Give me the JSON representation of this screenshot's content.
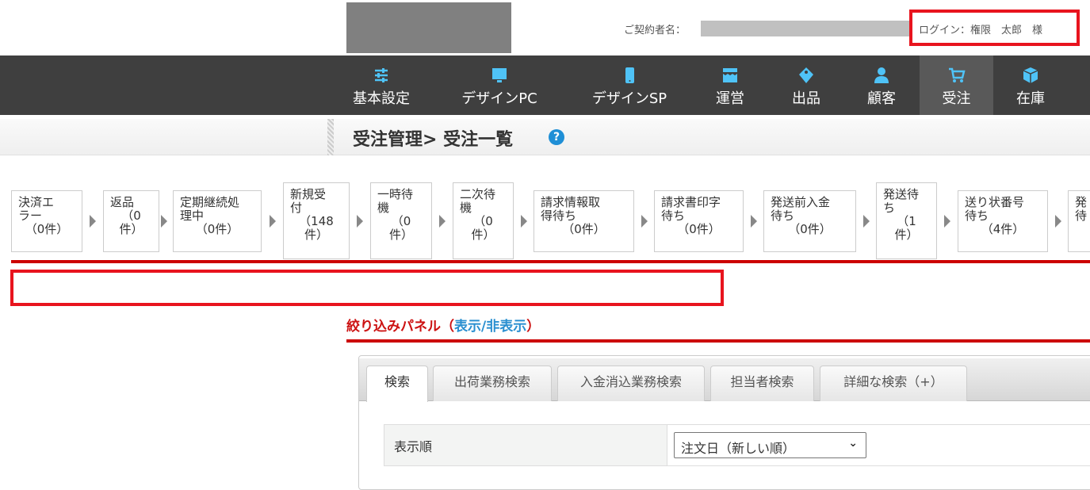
{
  "header": {
    "contract_label": "ご契約者名：",
    "login_text": "ログイン：権限　太郎　様"
  },
  "nav": {
    "items": [
      {
        "label": "基本設定",
        "icon": "sliders-icon"
      },
      {
        "label": "デザインPC",
        "icon": "monitor-icon"
      },
      {
        "label": "デザインSP",
        "icon": "smartphone-icon"
      },
      {
        "label": "運営",
        "icon": "store-icon"
      },
      {
        "label": "出品",
        "icon": "tag-icon"
      },
      {
        "label": "顧客",
        "icon": "user-icon"
      },
      {
        "label": "受注",
        "icon": "cart-icon",
        "active": true
      },
      {
        "label": "在庫",
        "icon": "box-icon"
      }
    ],
    "icon_color": "#4fc3f7"
  },
  "page": {
    "title": "受注管理> 受注一覧",
    "help": "?"
  },
  "statuses": [
    {
      "label": "決済エ\nラー",
      "count": "（0件）"
    },
    {
      "label": "返品",
      "count": "（0\n件）"
    },
    {
      "label": "定期継続処\n理中",
      "count": "（0件）"
    },
    {
      "label": "新規受\n付",
      "count": "（148\n件）"
    },
    {
      "label": "一時待\n機",
      "count": "（0\n件）"
    },
    {
      "label": "二次待\n機",
      "count": "（0\n件）"
    },
    {
      "label": "請求情報取\n得待ち",
      "count": "（0件）"
    },
    {
      "label": "請求書印字\n待ち",
      "count": "（0件）"
    },
    {
      "label": "発送前入金\n待ち",
      "count": "（0件）"
    },
    {
      "label": "発送待\nち",
      "count": "（1\n件）"
    },
    {
      "label": "送り状番号\n待ち",
      "count": "（4件）"
    },
    {
      "label": "発\n待",
      "count": ""
    }
  ],
  "filter": {
    "title": "絞り込みパネル（",
    "toggle_link": "表示/非表示",
    "title_end": "）"
  },
  "tabs": [
    "検索",
    "出荷業務検索",
    "入金消込業務検索",
    "担当者検索",
    "詳細な検索（+）"
  ],
  "form": {
    "sort_label": "表示順",
    "sort_value": "注文日（新しい順）"
  }
}
